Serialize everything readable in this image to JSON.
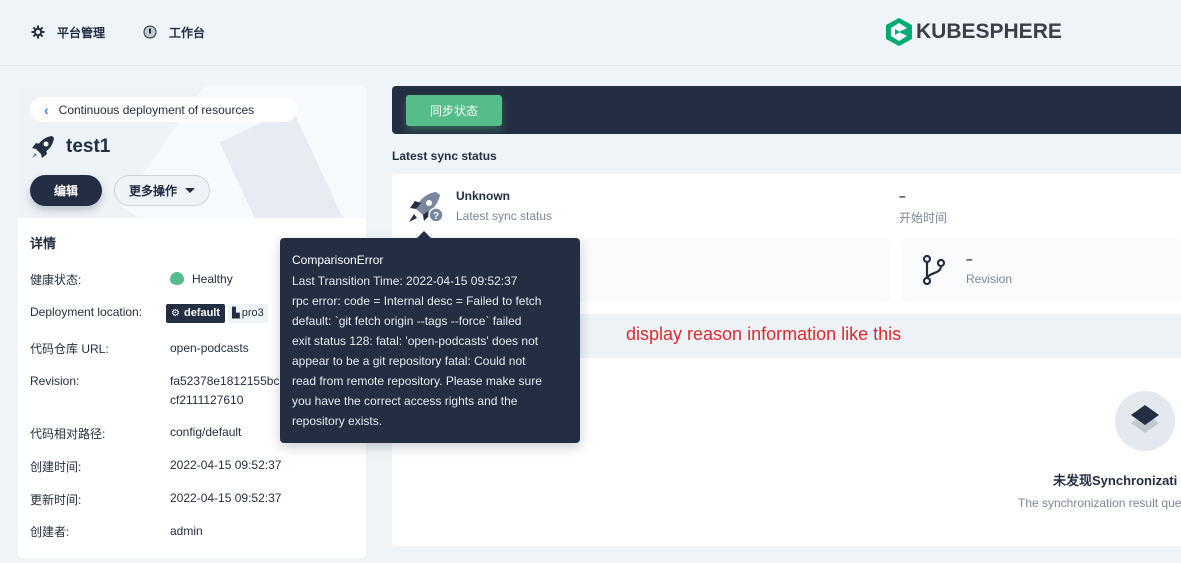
{
  "nav": {
    "platform_label": "平台管理",
    "workbench_label": "工作台",
    "logo_text": "KUBESPHERE"
  },
  "left": {
    "back_label": "Continuous deployment of resources",
    "app_name": "test1",
    "edit_label": "编辑",
    "more_label": "更多操作",
    "details_title": "详情",
    "rows": {
      "health_key": "健康状态:",
      "health_value": "Healthy",
      "location_key": "Deployment location:",
      "location_ns": "default",
      "location_project": "pro3",
      "repo_key": "代码仓库 URL:",
      "repo_value": "open-podcasts",
      "revision_key": "Revision:",
      "revision_line1": "fa52378e1812155bc",
      "revision_line2": "cf2111127610",
      "path_key": "代码相对路径:",
      "path_value": "config/default",
      "created_key": "创建时间:",
      "created_value": "2022-04-15 09:52:37",
      "updated_key": "更新时间:",
      "updated_value": "2022-04-15 09:52:37",
      "creator_key": "创建者:",
      "creator_value": "admin"
    }
  },
  "right": {
    "sync_button": "同步状态",
    "section_title": "Latest sync status",
    "status_value": "Unknown",
    "status_label": "Latest sync status",
    "start_value": "–",
    "start_label": "开始时间",
    "revision_value": "–",
    "revision_label": "Revision",
    "annotation": "display reason information like this",
    "empty_title": "未发现Synchronizati",
    "empty_desc": "The synchronization result que"
  },
  "tooltip": {
    "title": "ComparisonError",
    "body_line1": "Last Transition Time:  2022-04-15 09:52:37",
    "body_line2": "rpc error: code = Internal desc = Failed to fetch",
    "body_line3": "default: `git fetch origin --tags --force` failed",
    "body_line4": "exit status 128: fatal: 'open-podcasts' does not",
    "body_line5": "appear to be a git repository fatal: Could not",
    "body_line6": "read from remote repository. Please make sure",
    "body_line7": "you have the correct access rights and the",
    "body_line8": "repository exists."
  },
  "colors": {
    "primary_dark": "#242e42",
    "success": "#55bc8a",
    "link": "#3385ff",
    "annotation_red": "#e0292d",
    "muted": "#79879c"
  }
}
